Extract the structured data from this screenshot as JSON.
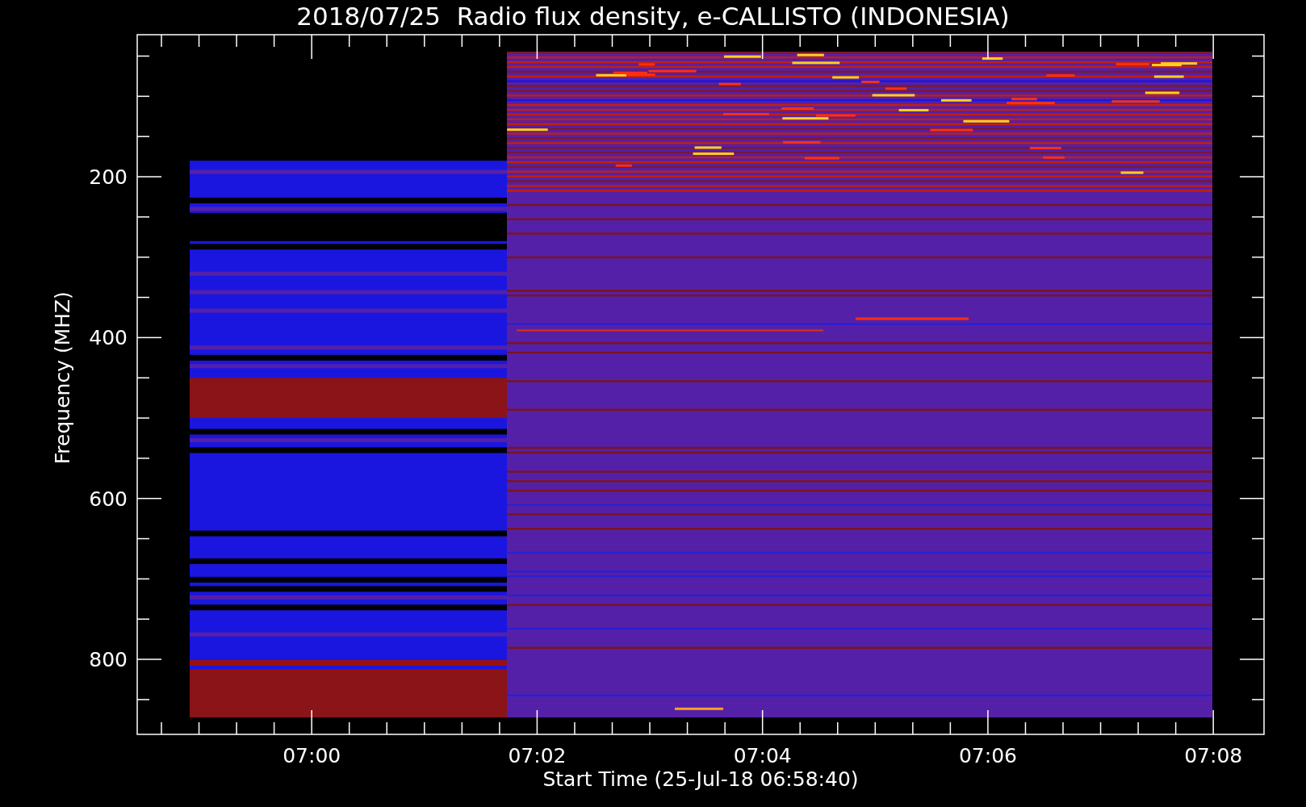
{
  "title": "2018/07/25  Radio flux density, e-CALLISTO (INDONESIA)",
  "plot": {
    "ylabel": "Frequency (MHZ)",
    "xlabel": "Start Time (25-Jul-18 06:58:40)",
    "yticks": [
      "200",
      "400",
      "600",
      "800"
    ],
    "xticks": [
      "07:00",
      "07:02",
      "07:04",
      "07:06",
      "07:08"
    ]
  }
}
